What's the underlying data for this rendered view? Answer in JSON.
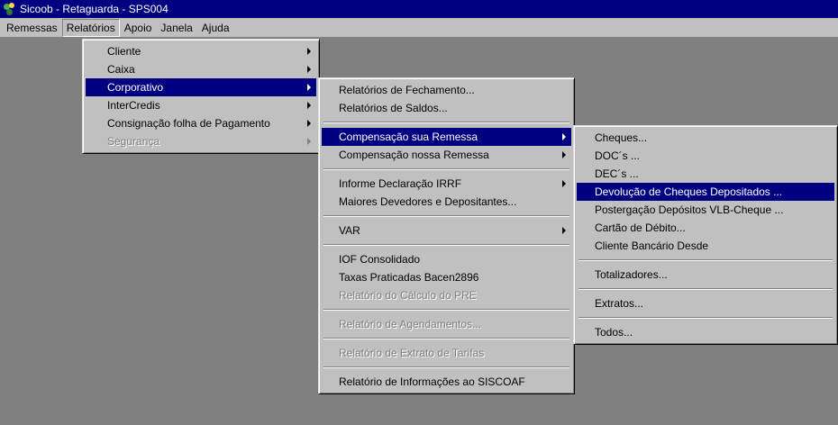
{
  "window": {
    "title": "Sicoob - Retaguarda - SPS004"
  },
  "menubar": {
    "items": [
      {
        "label": "Remessas"
      },
      {
        "label": "Relatórios"
      },
      {
        "label": "Apoio"
      },
      {
        "label": "Janela"
      },
      {
        "label": "Ajuda"
      }
    ]
  },
  "relatorios_menu": {
    "items": [
      {
        "label": "Cliente"
      },
      {
        "label": "Caixa"
      },
      {
        "label": "Corporativo"
      },
      {
        "label": "InterCredis"
      },
      {
        "label": "Consignação folha de Pagamento"
      },
      {
        "label": "Segurança"
      }
    ]
  },
  "corporativo_menu": {
    "items": [
      {
        "label": "Relatórios de Fechamento..."
      },
      {
        "label": "Relatórios de Saldos..."
      },
      {
        "label": "Compensação sua Remessa"
      },
      {
        "label": "Compensação nossa Remessa"
      },
      {
        "label": "Informe Declaração IRRF"
      },
      {
        "label": "Maiores Devedores e Depositantes..."
      },
      {
        "label": "VAR"
      },
      {
        "label": "IOF Consolidado"
      },
      {
        "label": "Taxas Praticadas Bacen2896"
      },
      {
        "label": "Relatório do Cálculo do PRE"
      },
      {
        "label": "Relatório de Agendamentos..."
      },
      {
        "label": "Relatório de Extrato de Tarifas"
      },
      {
        "label": "Relatório de Informações ao SISCOAF"
      }
    ]
  },
  "compensacao_menu": {
    "items": [
      {
        "label": "Cheques..."
      },
      {
        "label": "DOC´s ..."
      },
      {
        "label": "DEC´s ..."
      },
      {
        "label": "Devolução de Cheques Depositados ..."
      },
      {
        "label": "Postergação Depósitos VLB-Cheque ..."
      },
      {
        "label": "Cartão de Débito..."
      },
      {
        "label": "Cliente Bancário Desde"
      },
      {
        "label": "Totalizadores..."
      },
      {
        "label": "Extratos..."
      },
      {
        "label": "Todos..."
      }
    ]
  },
  "colors": {
    "titlebar": "#000080",
    "highlight": "#000080",
    "face": "#c0c0c0",
    "desktop": "#808080"
  }
}
